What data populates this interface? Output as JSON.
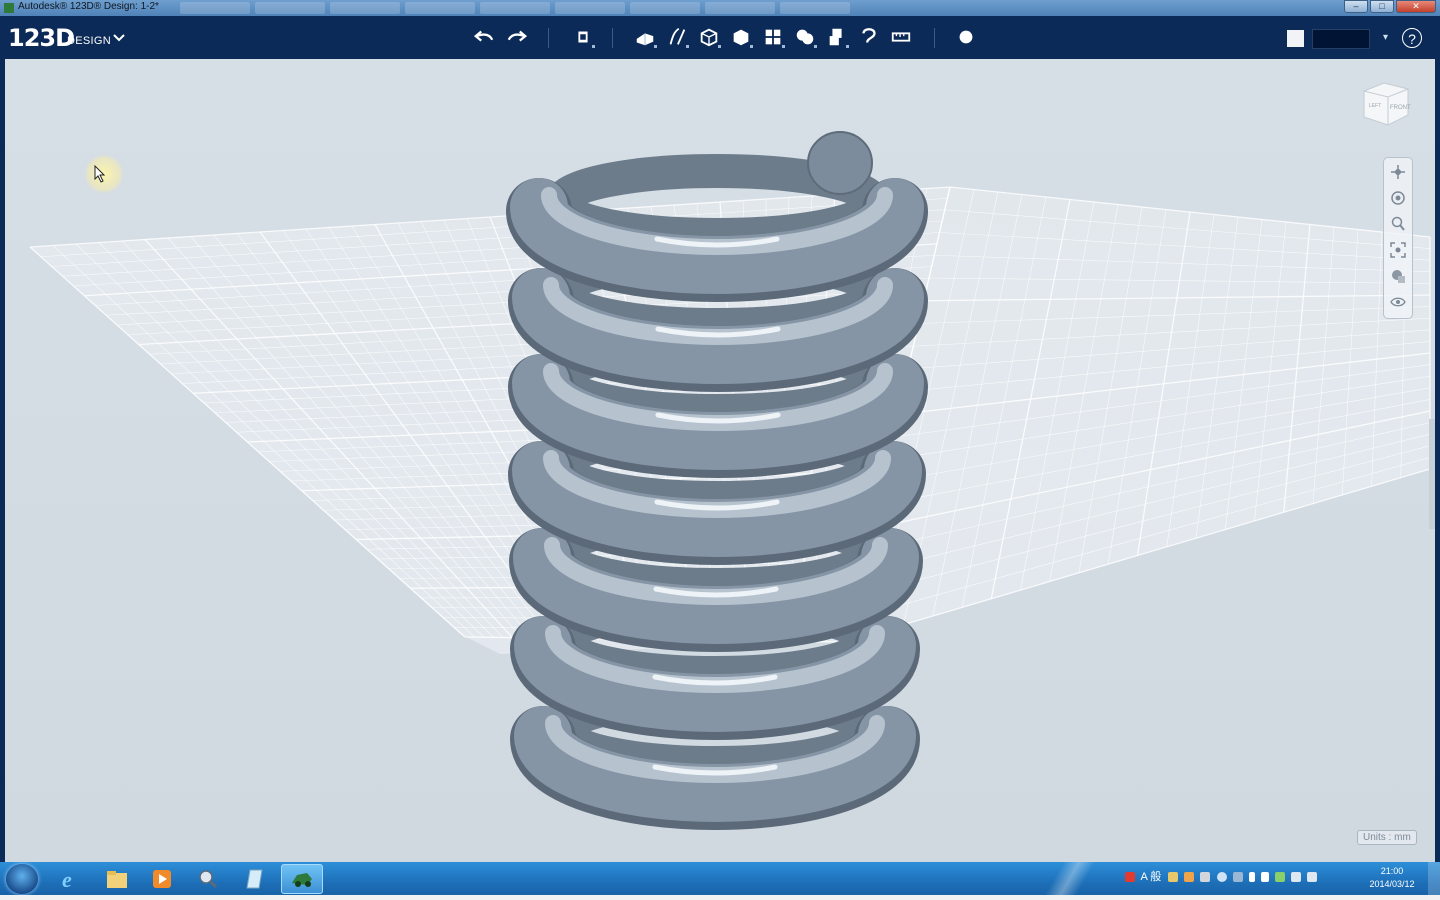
{
  "window": {
    "title": "Autodesk® 123D® Design: 1-2*",
    "controls": [
      "minimize-icon",
      "maximize-icon",
      "close-icon"
    ]
  },
  "app": {
    "logo": "123D",
    "logo_sub": "DESIGN",
    "menu_icon": "chevron-down-icon"
  },
  "toolbar": {
    "tools": [
      "undo-icon",
      "redo-icon",
      "transform-icon",
      "primitives-icon",
      "sketch-icon",
      "construct-icon",
      "modify-icon",
      "pattern-icon",
      "grouping-icon",
      "combine-icon",
      "snap-icon",
      "measure-icon",
      "material-icon"
    ],
    "right": [
      "material-swatch",
      "material-selector",
      "help-icon"
    ],
    "help_label": "?"
  },
  "viewport": {
    "viewcube_left": "LEFT",
    "viewcube_front": "FRONT",
    "nav_tools": [
      "pan-icon",
      "orbit-icon",
      "zoom-icon",
      "fit-icon",
      "material-view-icon",
      "visibility-icon"
    ],
    "units_label": "Units : mm"
  },
  "taskbar": {
    "apps": [
      "start-button",
      "internet-explorer-icon",
      "file-explorer-icon",
      "media-player-icon",
      "search-app-icon",
      "notepad-icon",
      "123d-design-icon"
    ],
    "tray_text": "A 般",
    "clock_time": "21:00",
    "clock_date": "2014/03/12"
  },
  "colors": {
    "app_bar": "#0b2a57",
    "viewport_bg": "#d4dce4",
    "spring": "#7c8c9c",
    "taskbar": "#1d6fb8"
  }
}
